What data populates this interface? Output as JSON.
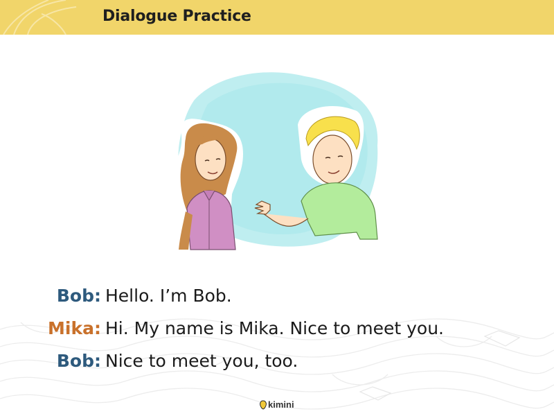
{
  "header": {
    "title": "Dialogue Practice",
    "bar_color": "#f1d56a"
  },
  "illustration": {
    "alt": "two-people-greeting-illustration",
    "icons": [
      "woman-figure",
      "man-waving-figure"
    ]
  },
  "dialogue": {
    "lines": [
      {
        "speaker": "Bob:",
        "text": "Hello. I’m Bob.",
        "color": "#2e5a7d"
      },
      {
        "speaker": "Mika:",
        "text": "Hi. My name is Mika. Nice to meet you.",
        "color": "#c9712b"
      },
      {
        "speaker": "Bob:",
        "text": "Nice to meet you, too.",
        "color": "#2e5a7d"
      }
    ]
  },
  "footer": {
    "logo_text": "kimini"
  }
}
